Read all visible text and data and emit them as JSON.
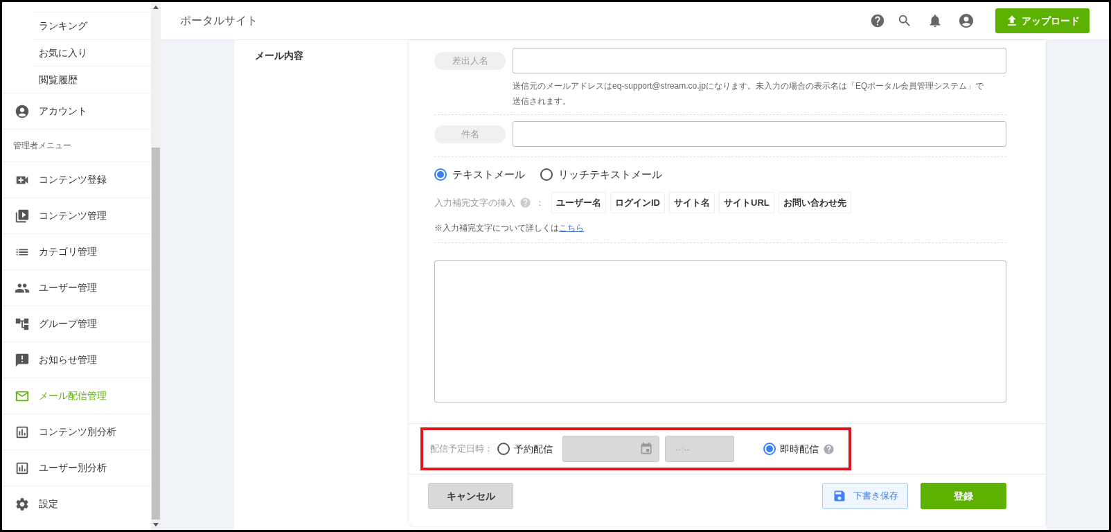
{
  "header": {
    "title": "ポータルサイト",
    "upload_button": "アップロード"
  },
  "sidebar": {
    "items": [
      {
        "kind": "sub",
        "label": "ランキング"
      },
      {
        "kind": "sub",
        "label": "お気に入り"
      },
      {
        "kind": "sub",
        "label": "閲覧履歴"
      },
      {
        "kind": "nav",
        "label": "アカウント",
        "selected": false
      },
      {
        "kind": "section",
        "label": "管理者メニュー"
      },
      {
        "kind": "nav",
        "label": "コンテンツ登録",
        "selected": false
      },
      {
        "kind": "nav",
        "label": "コンテンツ管理",
        "selected": false
      },
      {
        "kind": "nav",
        "label": "カテゴリ管理",
        "selected": false
      },
      {
        "kind": "nav",
        "label": "ユーザー管理",
        "selected": false
      },
      {
        "kind": "nav",
        "label": "グループ管理",
        "selected": false
      },
      {
        "kind": "nav",
        "label": "お知らせ管理",
        "selected": false
      },
      {
        "kind": "nav",
        "label": "メール配信管理",
        "selected": true
      },
      {
        "kind": "nav",
        "label": "コンテンツ別分析",
        "selected": false
      },
      {
        "kind": "nav",
        "label": "ユーザー別分析",
        "selected": false
      },
      {
        "kind": "nav",
        "label": "設定",
        "selected": false
      }
    ]
  },
  "form": {
    "section_label": "メール内容",
    "sender": {
      "label": "差出人名",
      "hint": "送信元のメールアドレスはeq-support@stream.co.jpになります。未入力の場合の表示名は「EQポータル会員管理システム」で送信されます。"
    },
    "subject": {
      "label": "件名"
    },
    "formats": [
      {
        "label": "テキストメール",
        "selected": true
      },
      {
        "label": "リッチテキストメール",
        "selected": false
      }
    ],
    "insert": {
      "label": "入力補完文字の挿入",
      "separator": "：",
      "tags": [
        "ユーザー名",
        "ログインID",
        "サイト名",
        "サイトURL",
        "お問い合わせ先"
      ]
    },
    "note": {
      "text": "※入力補完文字について詳しくは",
      "link": "こちら"
    },
    "schedule": {
      "label": "配信予定日時：",
      "options": [
        {
          "label": "予約配信",
          "selected": false
        },
        {
          "label": "即時配信",
          "selected": true
        }
      ],
      "time_placeholder": "--:--"
    },
    "buttons": {
      "cancel": "キャンセル",
      "draft": "下書き保存",
      "submit": "登録"
    }
  }
}
